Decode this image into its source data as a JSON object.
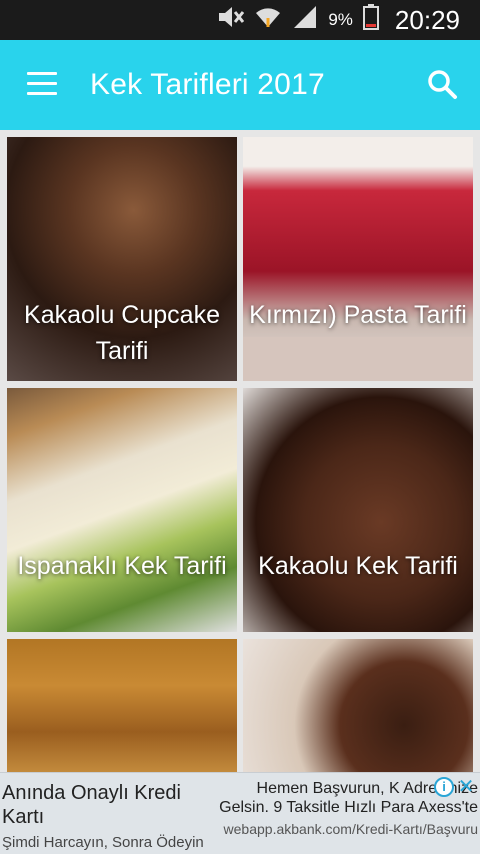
{
  "status_bar": {
    "battery_percent": "9%",
    "time": "20:29",
    "icons": [
      "mute-icon",
      "wifi-icon",
      "signal-icon",
      "battery-icon"
    ]
  },
  "app_bar": {
    "title": "Kek Tarifleri 2017",
    "menu_icon": "hamburger-menu-icon",
    "search_icon": "search-icon",
    "color": "#29d3ec"
  },
  "recipes": [
    {
      "label": "Kakaolu Cupcake Tarifi"
    },
    {
      "label": "Kırmızı) Pasta Tarifi"
    },
    {
      "label": "Ispanaklı Kek Tarifi"
    },
    {
      "label": "Kakaolu Kek Tarifi"
    },
    {
      "label": ""
    },
    {
      "label": ""
    }
  ],
  "ad": {
    "headline": "Anında Onaylı Kredi Kartı",
    "subtext": "Şimdi Harcayın, Sonra Ödeyin",
    "right_text": "Hemen Başvurun, K Adresinize Gelsin. 9 Taksitle Hızlı Para Axess'te",
    "url": "webapp.akbank.com/Kredi-Kartı/Başvuru",
    "info_icon": "i",
    "close_icon": "✕"
  }
}
